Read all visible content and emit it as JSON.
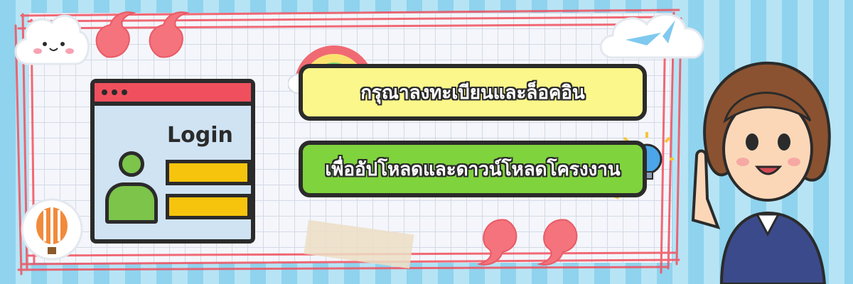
{
  "login_card": {
    "title": "Login"
  },
  "messages": {
    "line1": "กรุณาลงทะเบียนและล็อคอิน",
    "line2": "เพื่ออัปโหลดและดาวน์โหลดโครงงาน"
  },
  "colors": {
    "background_stripe_dark": "#8fd3ee",
    "background_stripe_light": "#b6e4f5",
    "frame_red": "#f0505d",
    "pill_yellow": "#fbf78a",
    "pill_green": "#7fd33d",
    "field_yellow": "#f6c40c",
    "avatar_green": "#7cc44a",
    "outline": "#2b2b2b"
  },
  "icons": [
    "cloud-face-icon",
    "quote-open-icon",
    "quote-close-icon",
    "rainbow-cloud-icon",
    "paper-plane-cloud-icon",
    "hot-air-balloon-icon",
    "lightbulb-rocket-icon",
    "woman-pointing-illustration"
  ]
}
